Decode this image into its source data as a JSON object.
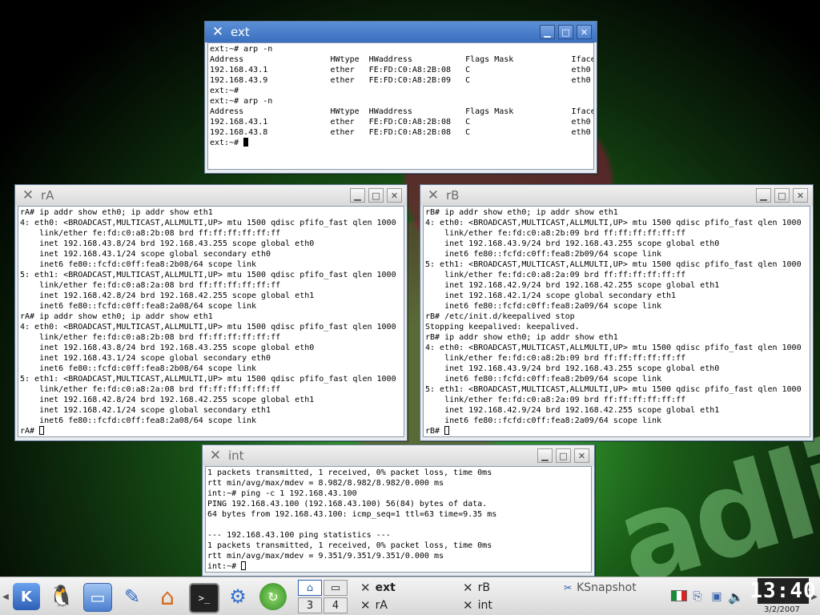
{
  "windows": {
    "ext": {
      "title": "ext",
      "terminal": "ext:~# arp -n\nAddress                  HWtype  HWaddress           Flags Mask            Iface\n192.168.43.1             ether   FE:FD:C0:A8:2B:08   C                     eth0\n192.168.43.9             ether   FE:FD:C0:A8:2B:09   C                     eth0\next:~#\next:~# arp -n\nAddress                  HWtype  HWaddress           Flags Mask            Iface\n192.168.43.1             ether   FE:FD:C0:A8:2B:08   C                     eth0\n192.168.43.8             ether   FE:FD:C0:A8:2B:08   C                     eth0\next:~# "
    },
    "rA": {
      "title": "rA",
      "terminal": "rA# ip addr show eth0; ip addr show eth1\n4: eth0: <BROADCAST,MULTICAST,ALLMULTI,UP> mtu 1500 qdisc pfifo_fast qlen 1000\n    link/ether fe:fd:c0:a8:2b:08 brd ff:ff:ff:ff:ff:ff\n    inet 192.168.43.8/24 brd 192.168.43.255 scope global eth0\n    inet 192.168.43.1/24 scope global secondary eth0\n    inet6 fe80::fcfd:c0ff:fea8:2b08/64 scope link\n5: eth1: <BROADCAST,MULTICAST,ALLMULTI,UP> mtu 1500 qdisc pfifo_fast qlen 1000\n    link/ether fe:fd:c0:a8:2a:08 brd ff:ff:ff:ff:ff:ff\n    inet 192.168.42.8/24 brd 192.168.42.255 scope global eth1\n    inet6 fe80::fcfd:c0ff:fea8:2a08/64 scope link\nrA# ip addr show eth0; ip addr show eth1\n4: eth0: <BROADCAST,MULTICAST,ALLMULTI,UP> mtu 1500 qdisc pfifo_fast qlen 1000\n    link/ether fe:fd:c0:a8:2b:08 brd ff:ff:ff:ff:ff:ff\n    inet 192.168.43.8/24 brd 192.168.43.255 scope global eth0\n    inet 192.168.43.1/24 scope global secondary eth0\n    inet6 fe80::fcfd:c0ff:fea8:2b08/64 scope link\n5: eth1: <BROADCAST,MULTICAST,ALLMULTI,UP> mtu 1500 qdisc pfifo_fast qlen 1000\n    link/ether fe:fd:c0:a8:2a:08 brd ff:ff:ff:ff:ff:ff\n    inet 192.168.42.8/24 brd 192.168.42.255 scope global eth1\n    inet 192.168.42.1/24 scope global secondary eth1\n    inet6 fe80::fcfd:c0ff:fea8:2a08/64 scope link\nrA# "
    },
    "rB": {
      "title": "rB",
      "terminal": "rB# ip addr show eth0; ip addr show eth1\n4: eth0: <BROADCAST,MULTICAST,ALLMULTI,UP> mtu 1500 qdisc pfifo_fast qlen 1000\n    link/ether fe:fd:c0:a8:2b:09 brd ff:ff:ff:ff:ff:ff\n    inet 192.168.43.9/24 brd 192.168.43.255 scope global eth0\n    inet6 fe80::fcfd:c0ff:fea8:2b09/64 scope link\n5: eth1: <BROADCAST,MULTICAST,ALLMULTI,UP> mtu 1500 qdisc pfifo_fast qlen 1000\n    link/ether fe:fd:c0:a8:2a:09 brd ff:ff:ff:ff:ff:ff\n    inet 192.168.42.9/24 brd 192.168.42.255 scope global eth1\n    inet 192.168.42.1/24 scope global secondary eth1\n    inet6 fe80::fcfd:c0ff:fea8:2a09/64 scope link\nrB# /etc/init.d/keepalived stop\nStopping keepalived: keepalived.\nrB# ip addr show eth0; ip addr show eth1\n4: eth0: <BROADCAST,MULTICAST,ALLMULTI,UP> mtu 1500 qdisc pfifo_fast qlen 1000\n    link/ether fe:fd:c0:a8:2b:09 brd ff:ff:ff:ff:ff:ff\n    inet 192.168.43.9/24 brd 192.168.43.255 scope global eth0\n    inet6 fe80::fcfd:c0ff:fea8:2b09/64 scope link\n5: eth1: <BROADCAST,MULTICAST,ALLMULTI,UP> mtu 1500 qdisc pfifo_fast qlen 1000\n    link/ether fe:fd:c0:a8:2a:09 brd ff:ff:ff:ff:ff:ff\n    inet 192.168.42.9/24 brd 192.168.42.255 scope global eth1\n    inet6 fe80::fcfd:c0ff:fea8:2a09/64 scope link\nrB# "
    },
    "int": {
      "title": "int",
      "terminal": "1 packets transmitted, 1 received, 0% packet loss, time 0ms\nrtt min/avg/max/mdev = 8.982/8.982/8.982/0.000 ms\nint:~# ping -c 1 192.168.43.100\nPING 192.168.43.100 (192.168.43.100) 56(84) bytes of data.\n64 bytes from 192.168.43.100: icmp_seq=1 ttl=63 time=9.35 ms\n\n--- 192.168.43.100 ping statistics ---\n1 packets transmitted, 1 received, 0% packet loss, time 0ms\nrtt min/avg/max/mdev = 9.351/9.351/9.351/0.000 ms\nint:~# "
    }
  },
  "taskbar": {
    "pager": [
      "3",
      "4"
    ],
    "tasks": {
      "ext": "ext",
      "rA": "rA",
      "rB": "rB",
      "int": "int",
      "ksnapshot": "KSnapshot"
    },
    "clock": "13:40",
    "date": "3/2/2007"
  },
  "background": {
    "wordmark": "adli"
  }
}
